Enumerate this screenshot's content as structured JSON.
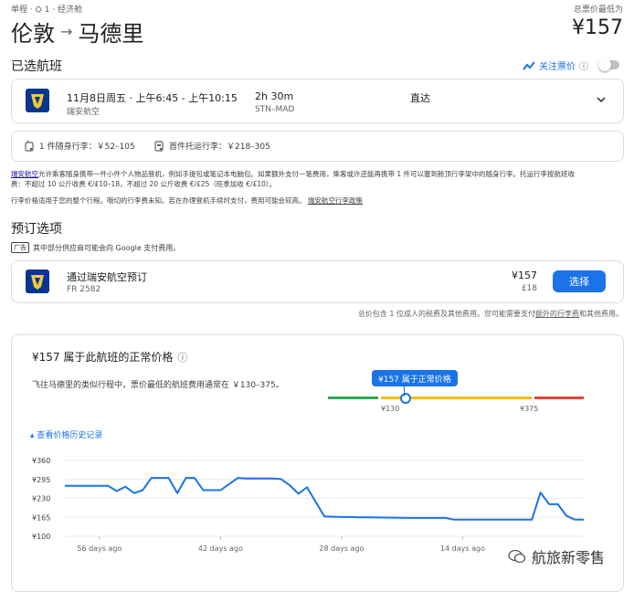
{
  "header": {
    "meta": "单程 · ⛭ 1 · 经济舱",
    "origin": "伦敦",
    "arrow": "→",
    "destination": "马德里",
    "total_label": "总票价最低为",
    "total_price": "¥157"
  },
  "selected": {
    "title": "已选航班",
    "track_label": "关注票价",
    "info_glyph": "ⓘ",
    "track_on": false
  },
  "flight": {
    "date_time": "11月8日周五 · 上午6:45 - 上午10:15",
    "airline": "瑞安航空",
    "duration": "2h 30m",
    "route": "STN–MAD",
    "stops": "直达"
  },
  "baggage": {
    "carry_on": "1 件随身行李：￥52–105",
    "checked": "首件托运行李：￥218–305"
  },
  "notes": {
    "line1_link": "瑞安航空",
    "line1": "允许乘客随身携带一件小件个人物品登机，例如手提包或笔记本电脑包。如果额外支付一笔费用，乘客或许还能再携带 1 件可以塞到舱顶行李架中的随身行李。托运行李按航班收",
    "line2": "费：不超过 10 公斤收费 €/£10–18，不超过 20 公斤收费 €/£25（旺季加收 €/£10）。",
    "line3": "行李价格适用于您的整个行程。哦切的行李费未知。若在办理登机手续时支付，费用可能会较高。",
    "line3_link": "瑞安航空行李政策"
  },
  "booking": {
    "title": "预订选项",
    "ad_badge": "广告",
    "ad_text": "其中部分供应商可能会向 Google 支付费用。",
    "provider": "通过瑞安航空预订",
    "flight_no": "FR 2582",
    "price": "¥157",
    "price_alt": "£18",
    "select_label": "选择",
    "footnote": "总价包含 1 位成人的税费及其他费用。您可能需要支付",
    "footnote_link": "额外的行李费",
    "footnote_end": "和其他费用。"
  },
  "insights": {
    "title": "¥157 属于此航班的正常价格",
    "info_glyph": "ⓘ",
    "desc": "飞往马德里的类似行程中，票价最低的航班费用通常在 ￥130–375。",
    "badge": "¥157 属于正常价格",
    "low_label": "¥130",
    "high_label": "¥375",
    "history_label": "▴ 查看价格历史记录",
    "colors": {
      "low": "#34a853",
      "mid": "#fbbc04",
      "high": "#ea4335",
      "line": "#1a73e8"
    }
  },
  "watermark": "航旅新零售",
  "chart_data": {
    "type": "line",
    "title": "",
    "xlabel": "",
    "ylabel": "",
    "ylim": [
      100,
      360
    ],
    "yticks": [
      100,
      165,
      230,
      295,
      360
    ],
    "ytick_labels": [
      "¥100",
      "¥165",
      "¥230",
      "¥295",
      "¥360"
    ],
    "xlim": [
      -60,
      0
    ],
    "xticks": [
      -56,
      -42,
      -28,
      -14
    ],
    "xtick_labels": [
      "56 days ago",
      "42 days ago",
      "28 days ago",
      "14 days ago"
    ],
    "series": [
      {
        "x": [
          -60,
          -55,
          -54,
          -53,
          -52,
          -51,
          -50,
          -49,
          -48,
          -47,
          -46,
          -45,
          -44,
          -42,
          -40,
          -39,
          -38,
          -37,
          -36,
          -35,
          -34,
          -33,
          -32,
          -30,
          -29,
          -28,
          -27,
          -26,
          -25,
          -20,
          -16,
          -15,
          -14,
          -10,
          -6,
          -5,
          -4,
          -3,
          -2,
          -1,
          0
        ],
        "y": [
          273,
          273,
          255,
          270,
          248,
          258,
          300,
          300,
          300,
          248,
          300,
          300,
          258,
          258,
          300,
          298,
          298,
          298,
          298,
          296,
          275,
          246,
          268,
          168,
          167,
          166,
          166,
          165,
          165,
          163,
          163,
          157,
          157,
          157,
          157,
          250,
          210,
          210,
          170,
          157,
          157
        ]
      }
    ]
  }
}
